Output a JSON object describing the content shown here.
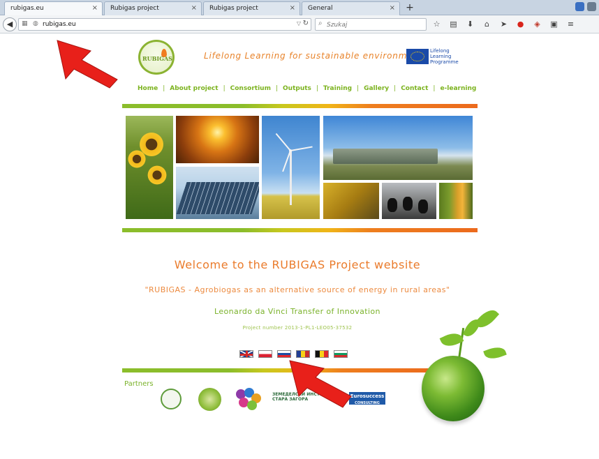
{
  "browser": {
    "tabs": [
      {
        "label": "rubigas.eu",
        "active": true
      },
      {
        "label": "Rubigas project",
        "active": false
      },
      {
        "label": "Rubigas project",
        "active": false
      },
      {
        "label": "General",
        "active": false
      }
    ],
    "new_tab_symbol": "+",
    "close_symbol": "×",
    "url": "rubigas.eu",
    "search_placeholder": "Szukaj"
  },
  "site": {
    "logo_text": "RUBIGAS",
    "tagline": "Lifelong Learning for sustainable environment",
    "programme_lines": [
      "Lifelong",
      "Learning",
      "Programme"
    ],
    "nav": [
      {
        "label": "Home"
      },
      {
        "label": "About project"
      },
      {
        "label": "Consortium"
      },
      {
        "label": "Outputs"
      },
      {
        "label": "Training"
      },
      {
        "label": "Gallery"
      },
      {
        "label": "Contact"
      },
      {
        "label": "e-learning"
      }
    ],
    "nav_separator": "|",
    "welcome": "Welcome to the RUBIGAS Project website",
    "subtitle": "\"RUBIGAS - Agrobiogas as an alternative source of energy in rural areas\"",
    "programme": "Leonardo da Vinci Transfer of Innovation",
    "project_number": "Project number 2013-1-PL1-LEO05-37532",
    "flags": [
      {
        "code": "EN"
      },
      {
        "code": "PL"
      },
      {
        "code": "SK"
      },
      {
        "code": "RO"
      },
      {
        "code": "BE"
      },
      {
        "code": "BG"
      }
    ],
    "partners_title": "Partners",
    "partner_logos": {
      "p4_lines": [
        "ЗЕМЕДЕЛСКИ ИНСТИТУТ",
        "СТАРА ЗАГОРА"
      ],
      "p5_lines": [
        "Eurosuccess",
        "CONSULTING"
      ]
    }
  },
  "colors": {
    "green": "#7ab22a",
    "orange": "#ea7b2b",
    "arrow_red": "#e8201a"
  }
}
